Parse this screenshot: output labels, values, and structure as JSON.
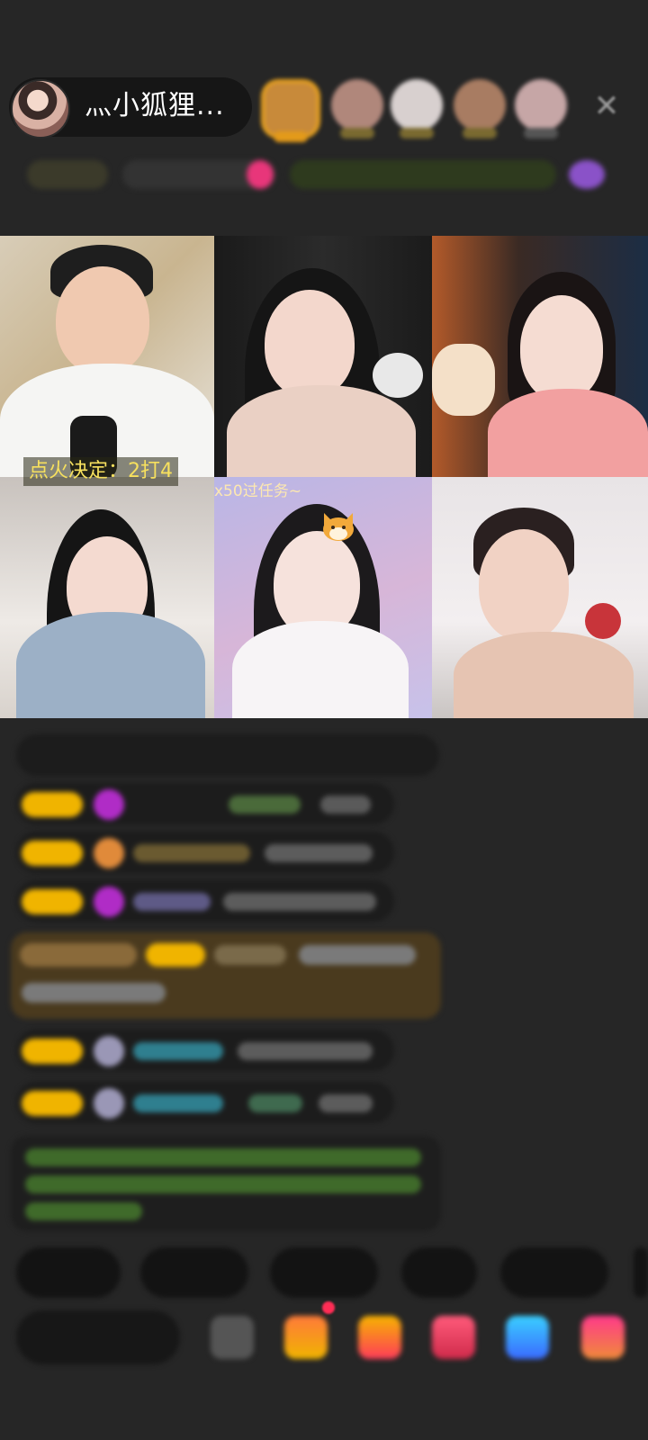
{
  "header": {
    "host_name": "灬小狐狸...",
    "close_icon": "close-icon",
    "viewer_count": 5
  },
  "grid": {
    "caption_left": "点火决定：2打4",
    "caption_task": "x50过任务~"
  },
  "colors": {
    "background": "#262626",
    "caption_yellow": "#f6e05e",
    "badge_gold": "#f0b400",
    "chat_green": "#6fcf2f",
    "chat_cyan": "#2fb3c9"
  },
  "chat": {
    "messages": 8
  },
  "bottom": {
    "chips": 5,
    "tools": 6
  }
}
